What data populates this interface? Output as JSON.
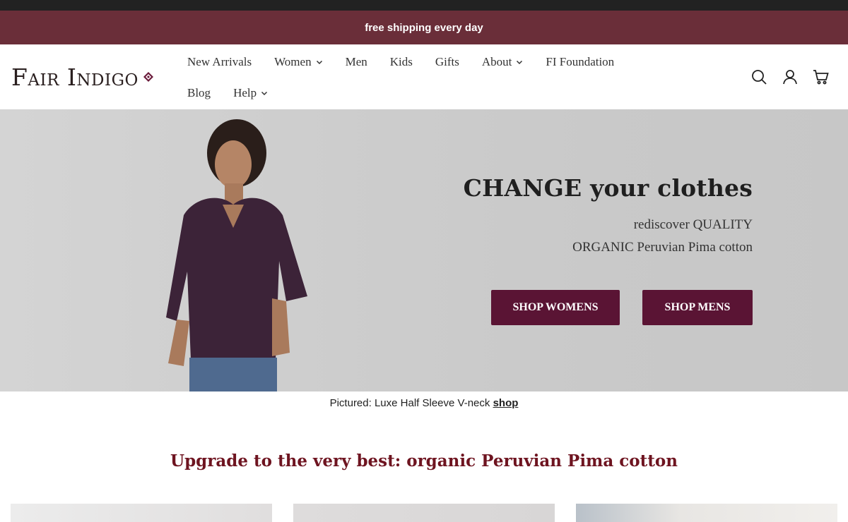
{
  "promo": {
    "text": "free shipping every day"
  },
  "brand": {
    "name": "Fair Indigo"
  },
  "nav": {
    "row1": [
      {
        "label": "New Arrivals",
        "has_menu": false
      },
      {
        "label": "Women",
        "has_menu": true
      },
      {
        "label": "Men",
        "has_menu": false
      },
      {
        "label": "Kids",
        "has_menu": false
      },
      {
        "label": "Gifts",
        "has_menu": false
      },
      {
        "label": "About",
        "has_menu": true
      },
      {
        "label": "FI Foundation",
        "has_menu": false
      }
    ],
    "row2": [
      {
        "label": "Blog",
        "has_menu": false
      },
      {
        "label": "Help",
        "has_menu": true
      }
    ]
  },
  "header_icons": [
    "search-icon",
    "account-icon",
    "cart-icon"
  ],
  "hero": {
    "title": "CHANGE your clothes",
    "subtitle_1": "rediscover QUALITY",
    "subtitle_2": "ORGANIC Peruvian Pima cotton",
    "button_women": "SHOP WOMENS",
    "button_men": "SHOP MENS"
  },
  "caption": {
    "text": "Pictured: Luxe Half Sleeve V-neck ",
    "link": "shop"
  },
  "section": {
    "heading": "Upgrade to the very best: organic Peruvian Pima cotton"
  },
  "colors": {
    "promo_bg": "#6a2e39",
    "button_bg": "#5a1434",
    "heading": "#6e1420"
  }
}
